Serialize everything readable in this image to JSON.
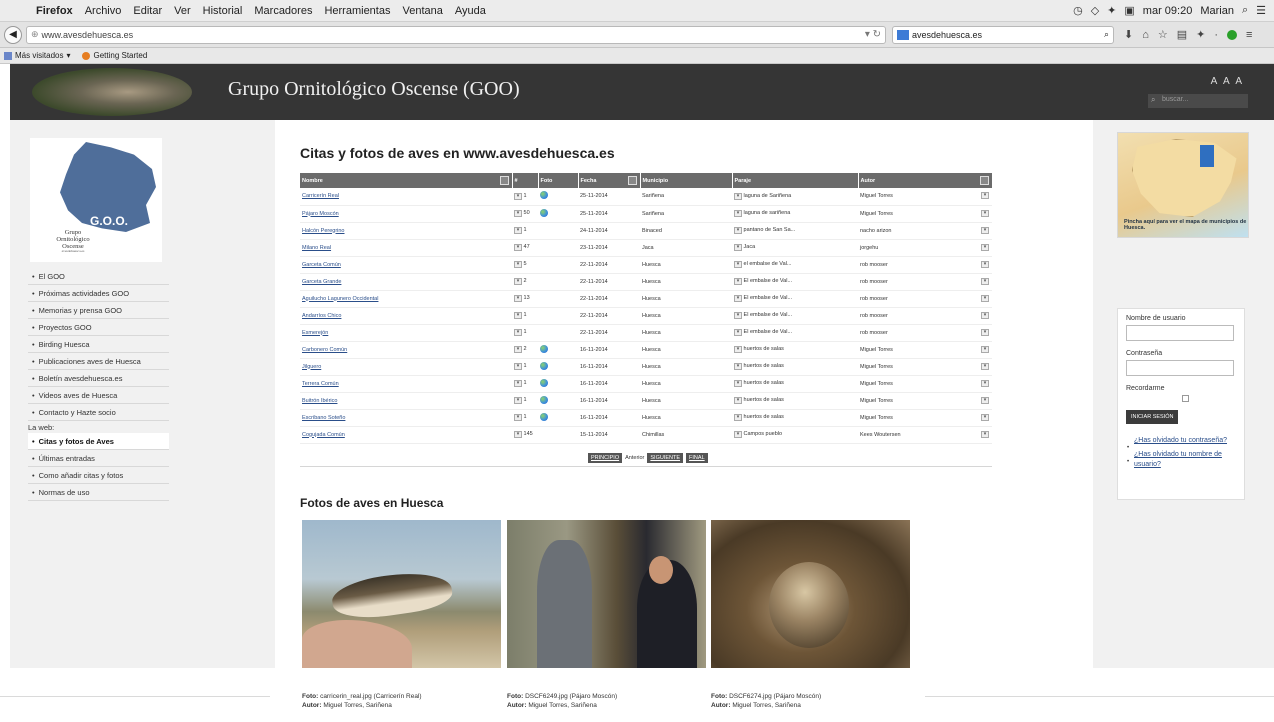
{
  "os_menubar": {
    "app": "Firefox",
    "items": [
      "Archivo",
      "Editar",
      "Ver",
      "Historial",
      "Marcadores",
      "Herramientas",
      "Ventana",
      "Ayuda"
    ],
    "clock": "mar 09:20",
    "user": "Marian"
  },
  "browser": {
    "url": "www.avesdehuesca.es",
    "search_text": "avesdehuesca.es",
    "bookmarks": [
      "Más visitados",
      "Getting Started"
    ]
  },
  "header": {
    "site_title": "Grupo Ornitológico Oscense (GOO)",
    "font_size_controls": "A A A",
    "search_placeholder": "buscar..."
  },
  "logo": {
    "goo": "G.O.O.",
    "text_line1": "Grupo",
    "text_line2": "Ornitológico",
    "text_line3": "Oscense",
    "small": "avesdehuesca.es"
  },
  "sidebar": {
    "items": [
      {
        "label": "El GOO",
        "active": false
      },
      {
        "label": "Próximas actividades GOO",
        "active": false
      },
      {
        "label": "Memorias y prensa GOO",
        "active": false
      },
      {
        "label": "Proyectos GOO",
        "active": false
      },
      {
        "label": "Birding Huesca",
        "active": false
      },
      {
        "label": "Publicaciones aves de Huesca",
        "active": false
      },
      {
        "label": "Boletín avesdehuesca.es",
        "active": false
      },
      {
        "label": "Videos aves de Huesca",
        "active": false
      },
      {
        "label": "Contacto y Hazte socio",
        "active": false
      }
    ],
    "web_heading": "La web:",
    "web_items": [
      {
        "label": "Citas y fotos de Aves",
        "active": true
      },
      {
        "label": "Últimas entradas",
        "active": false
      },
      {
        "label": "Como añadir citas y fotos",
        "active": false
      },
      {
        "label": "Normas de uso",
        "active": false
      }
    ]
  },
  "main": {
    "title": "Citas y fotos de aves en www.avesdehuesca.es",
    "table": {
      "headers": [
        "Nombre",
        "#",
        "Foto",
        "Fecha",
        "Municipio",
        "Paraje",
        "Autor"
      ],
      "rows": [
        {
          "nombre": "Carricerín Real",
          "n": "1",
          "foto": true,
          "fecha": "25-11-2014",
          "municipio": "Sariñena",
          "paraje": "laguna de Sariñena",
          "autor": "Miguel Torres"
        },
        {
          "nombre": "Pájaro Moscón",
          "n": "50",
          "foto": true,
          "fecha": "25-11-2014",
          "municipio": "Sariñena",
          "paraje": "laguna de sariñena",
          "autor": "Miguel Torres"
        },
        {
          "nombre": "Halcón Peregrino",
          "n": "1",
          "foto": false,
          "fecha": "24-11-2014",
          "municipio": "Binaced",
          "paraje": "pantano de San Sa...",
          "autor": "nacho arizon"
        },
        {
          "nombre": "Milano Real",
          "n": "47",
          "foto": false,
          "fecha": "23-11-2014",
          "municipio": "Jaca",
          "paraje": "Jaca",
          "autor": "jorgehu"
        },
        {
          "nombre": "Garceta Común",
          "n": "5",
          "foto": false,
          "fecha": "22-11-2014",
          "municipio": "Huesca",
          "paraje": "el embalse de Val...",
          "autor": "rob mooser"
        },
        {
          "nombre": "Garceta Grande",
          "n": "2",
          "foto": false,
          "fecha": "22-11-2014",
          "municipio": "Huesca",
          "paraje": "El embalse de Val...",
          "autor": "rob mooser"
        },
        {
          "nombre": "Aguilucho Lagunero Occidental",
          "n": "13",
          "foto": false,
          "fecha": "22-11-2014",
          "municipio": "Huesca",
          "paraje": "El embalse de Val...",
          "autor": "rob mooser"
        },
        {
          "nombre": "Andarríos Chico",
          "n": "1",
          "foto": false,
          "fecha": "22-11-2014",
          "municipio": "Huesca",
          "paraje": "El embalse de Val...",
          "autor": "rob mooser"
        },
        {
          "nombre": "Esmerejón",
          "n": "1",
          "foto": false,
          "fecha": "22-11-2014",
          "municipio": "Huesca",
          "paraje": "El embalse de Val...",
          "autor": "rob mooser"
        },
        {
          "nombre": "Carbonero Común",
          "n": "2",
          "foto": true,
          "fecha": "16-11-2014",
          "municipio": "Huesca",
          "paraje": "huertos de salas",
          "autor": "Miguel Torres"
        },
        {
          "nombre": "Jilguero",
          "n": "1",
          "foto": true,
          "fecha": "16-11-2014",
          "municipio": "Huesca",
          "paraje": "huertos de salas",
          "autor": "Miguel Torres"
        },
        {
          "nombre": "Terrera Común",
          "n": "1",
          "foto": true,
          "fecha": "16-11-2014",
          "municipio": "Huesca",
          "paraje": "huertos de salas",
          "autor": "Miguel Torres"
        },
        {
          "nombre": "Buitrón Ibérico",
          "n": "1",
          "foto": true,
          "fecha": "16-11-2014",
          "municipio": "Huesca",
          "paraje": "huertos de salas",
          "autor": "Miguel Torres"
        },
        {
          "nombre": "Escribano Soteño",
          "n": "1",
          "foto": true,
          "fecha": "16-11-2014",
          "municipio": "Huesca",
          "paraje": "huertos de salas",
          "autor": "Miguel Torres"
        },
        {
          "nombre": "Cogujada Común",
          "n": "145",
          "foto": false,
          "fecha": "15-11-2014",
          "municipio": "Chimillas",
          "paraje": "Campos pueblo",
          "autor": "Kees Woutersen"
        }
      ]
    },
    "pager": {
      "first": "PRINCIPIO",
      "prev": "Anterior",
      "next": "SIGUIENTE",
      "last": "FINAL"
    },
    "photos_title": "Fotos de aves en Huesca",
    "photos": [
      {
        "foto_label": "Foto:",
        "foto": "carricerin_real.jpg (Carricerín Real)",
        "autor_label": "Autor:",
        "autor": "Miguel Torres, Sariñena"
      },
      {
        "foto_label": "Foto:",
        "foto": "DSCF6249.jpg (Pájaro Moscón)",
        "autor_label": "Autor:",
        "autor": "Miguel Torres, Sariñena"
      },
      {
        "foto_label": "Foto:",
        "foto": "DSCF6274.jpg (Pájaro Moscón)",
        "autor_label": "Autor:",
        "autor": "Miguel Torres, Sariñena"
      }
    ]
  },
  "right": {
    "map_caption": "Pincha aquí para ver el mapa de municipios de Huesca.",
    "login": {
      "user_label": "Nombre de usuario",
      "pass_label": "Contraseña",
      "remember_label": "Recordarme",
      "submit": "INICIAR SESIÓN",
      "forgot_pass": "¿Has olvidado tu contraseña?",
      "forgot_user": "¿Has olvidado tu nombre de usuario?"
    }
  }
}
